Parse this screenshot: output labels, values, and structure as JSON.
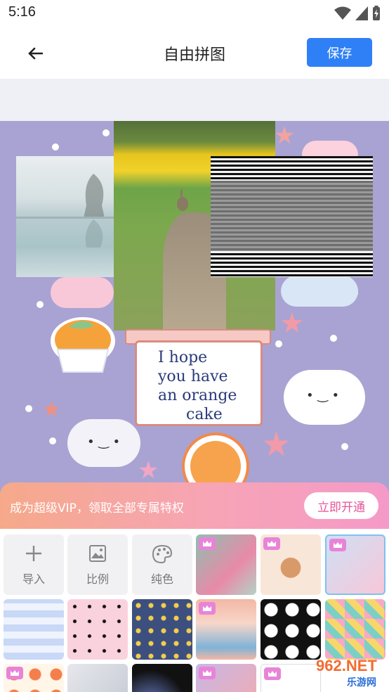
{
  "status_bar": {
    "time": "5:16"
  },
  "header": {
    "title": "自由拼图",
    "save_label": "保存"
  },
  "canvas": {
    "card_lines": [
      "I hope",
      "you have",
      "an orange",
      "cake"
    ]
  },
  "vip": {
    "text": "成为超级VIP，领取全部专属特权",
    "button_label": "立即开通"
  },
  "tools": [
    {
      "label": "导入",
      "icon": "plus-icon"
    },
    {
      "label": "比例",
      "icon": "image-icon"
    },
    {
      "label": "纯色",
      "icon": "palette-icon"
    }
  ],
  "backgrounds": [
    {
      "name": "tulips",
      "vip": true,
      "colors": [
        "#8dbfb0",
        "#e88aa8"
      ]
    },
    {
      "name": "teddy-bear",
      "vip": true,
      "colors": [
        "#f8e6d8",
        "#d99a6a"
      ]
    },
    {
      "name": "rainbow-bear",
      "vip": true,
      "colors": [
        "#cfe0f5",
        "#f7c7d8"
      ]
    },
    {
      "name": "blue-plaid-bows",
      "vip": false,
      "colors": [
        "#c8d8f6",
        "#f7b6d2"
      ]
    },
    {
      "name": "pink-bows",
      "vip": false,
      "colors": [
        "#fad2de",
        "#111111"
      ]
    },
    {
      "name": "navy-stars",
      "vip": false,
      "colors": [
        "#3d4f7f",
        "#f2cf4a"
      ]
    },
    {
      "name": "watercolor-roses",
      "vip": true,
      "colors": [
        "#f3b7a5",
        "#7fb3d8"
      ]
    },
    {
      "name": "daisies-black",
      "vip": false,
      "colors": [
        "#111111",
        "#ffffff"
      ]
    },
    {
      "name": "geometric-confetti",
      "vip": false,
      "colors": [
        "#f7a9c6",
        "#7ad0c4"
      ]
    },
    {
      "name": "fruits",
      "vip": true,
      "colors": [
        "#fff6e8",
        "#f57f4c"
      ]
    },
    {
      "name": "silver-glow",
      "vip": false,
      "colors": [
        "#e7e7ec",
        "#bfc6d0"
      ]
    },
    {
      "name": "dark-light-leak",
      "vip": false,
      "colors": [
        "#111111",
        "#6b7fc9"
      ]
    },
    {
      "name": "pastel-abstract",
      "vip": true,
      "colors": [
        "#c7b7e6",
        "#f7a9a9"
      ]
    },
    {
      "name": "cartoon-mice",
      "vip": true,
      "colors": [
        "#ffffff",
        "#222222"
      ]
    }
  ],
  "watermark": {
    "brand": "962.NET",
    "sub": "乐游网"
  }
}
